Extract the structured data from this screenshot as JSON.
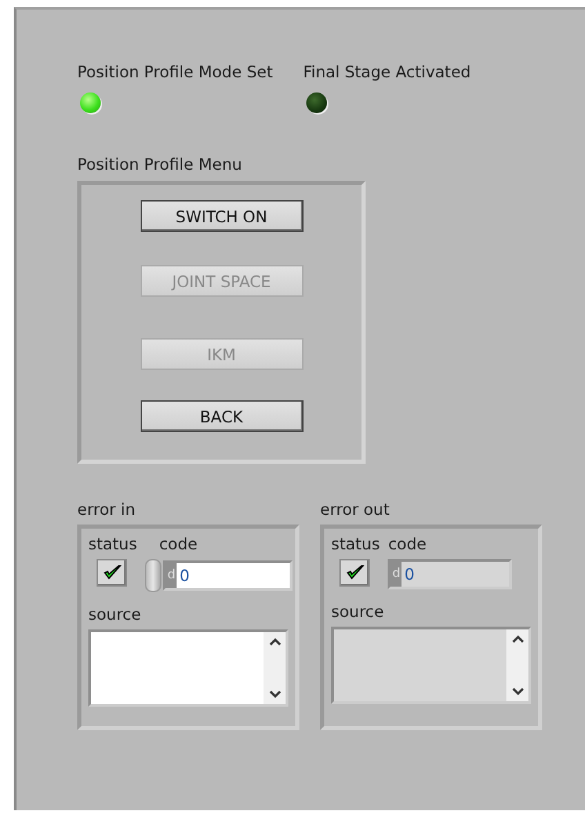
{
  "leds": [
    {
      "label": "Position Profile Mode Set",
      "on": true
    },
    {
      "label": "Final Stage Activated",
      "on": false
    }
  ],
  "menu": {
    "label": "Position Profile Menu",
    "buttons": [
      {
        "label": "SWITCH ON",
        "disabled": false
      },
      {
        "label": "JOINT SPACE",
        "disabled": true
      },
      {
        "label": "IKM",
        "disabled": true
      },
      {
        "label": "BACK",
        "disabled": false
      }
    ]
  },
  "clusters": [
    {
      "label": "error in",
      "kind": "control",
      "status_label": "status",
      "status": true,
      "code_label": "code",
      "radix": "d",
      "code": "0",
      "source_label": "source"
    },
    {
      "label": "error out",
      "kind": "indicator",
      "status_label": "status",
      "status": true,
      "code_label": "code",
      "radix": "d",
      "code": "0",
      "source_label": "source"
    }
  ]
}
